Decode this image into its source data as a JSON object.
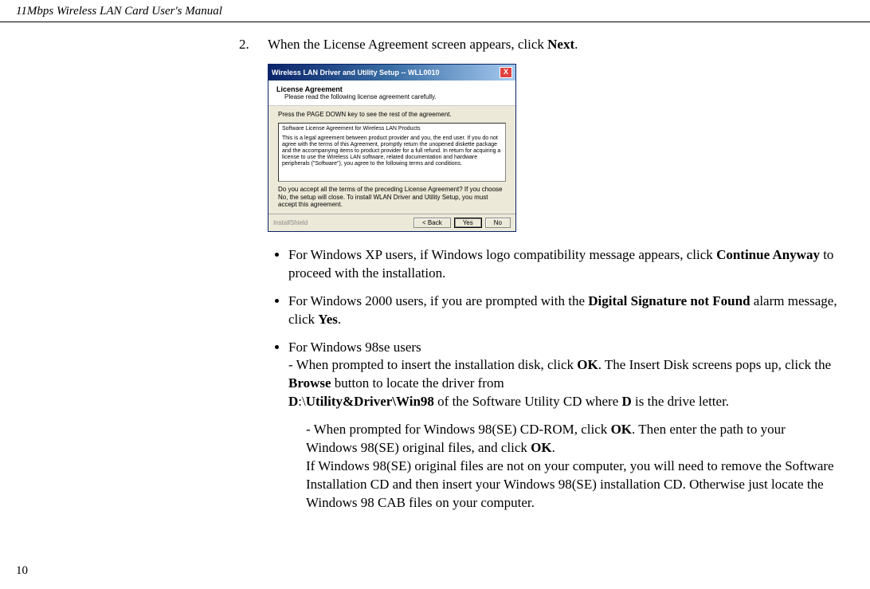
{
  "header": "11Mbps Wireless LAN Card User's Manual",
  "step": {
    "num": "2.",
    "text_pre": "When the License Agreement screen appears, click ",
    "text_bold": "Next",
    "text_post": "."
  },
  "dialog": {
    "title": "Wireless LAN Driver and Utility Setup -- WLL0010",
    "la_title": "License Agreement",
    "la_sub": "Please read the following license agreement carefully.",
    "instr": "Press the PAGE DOWN key to see the rest of the agreement.",
    "box_line1": "Software License Agreement for Wireless LAN Products",
    "box_body": "This is a legal agreement between product provider and you, the end user. If you do not agree with the terms of this Agreement, promptly return the unopened diskette package and the accompanying items to product provider for a full refund. In return for acquiring a license to use the Wireless LAN software, related documentation and hardware peripherals (\"Software\"), you agree to the following terms and conditions.",
    "q": "Do you accept all the terms of the preceding License Agreement? If you choose No, the setup will close. To install WLAN Driver and Utility Setup, you must accept this agreement.",
    "ishield": "InstallShield",
    "btn_back": "< Back",
    "btn_yes": "Yes",
    "btn_no": "No"
  },
  "bullets": {
    "xp_pre": "For Windows XP users, if Windows logo compatibility message appears, click ",
    "xp_bold": "Continue Anyway",
    "xp_post": " to proceed with the installation.",
    "w2k_pre": "For Windows 2000 users, if you are prompted with the ",
    "w2k_bold": "Digital Signature not Found",
    "w2k_mid": " alarm message, click ",
    "w2k_bold2": "Yes",
    "w2k_post": ".",
    "w98_intro": "For Windows 98se users",
    "w98_l1a": "- When prompted to insert the installation disk, click ",
    "w98_l1a_b": "OK",
    "w98_l1b": ". The Insert Disk screens pops up, click the ",
    "w98_l1b_b": "Browse",
    "w98_l1c": " button to locate the driver from ",
    "w98_l1d_b": "D",
    "w98_l1d": ":\\",
    "w98_l1e_b": "Utility&Driver\\Win98",
    "w98_l1f": " of the Software Utility CD where ",
    "w98_l1g_b": "D",
    "w98_l1g": " is the drive letter."
  },
  "subpara": {
    "a": "- When prompted for Windows 98(SE) CD-ROM, click ",
    "a_b": "OK",
    "b": ". Then enter the path to your Windows 98(SE) original files, and click ",
    "b_b": "OK",
    "c": ".",
    "d": "If Windows 98(SE) original files are not on your computer, you will need to remove the Software Installation CD and then insert your Windows 98(SE) installation CD. Otherwise just locate the Windows 98 CAB files on your computer."
  },
  "page": "10"
}
